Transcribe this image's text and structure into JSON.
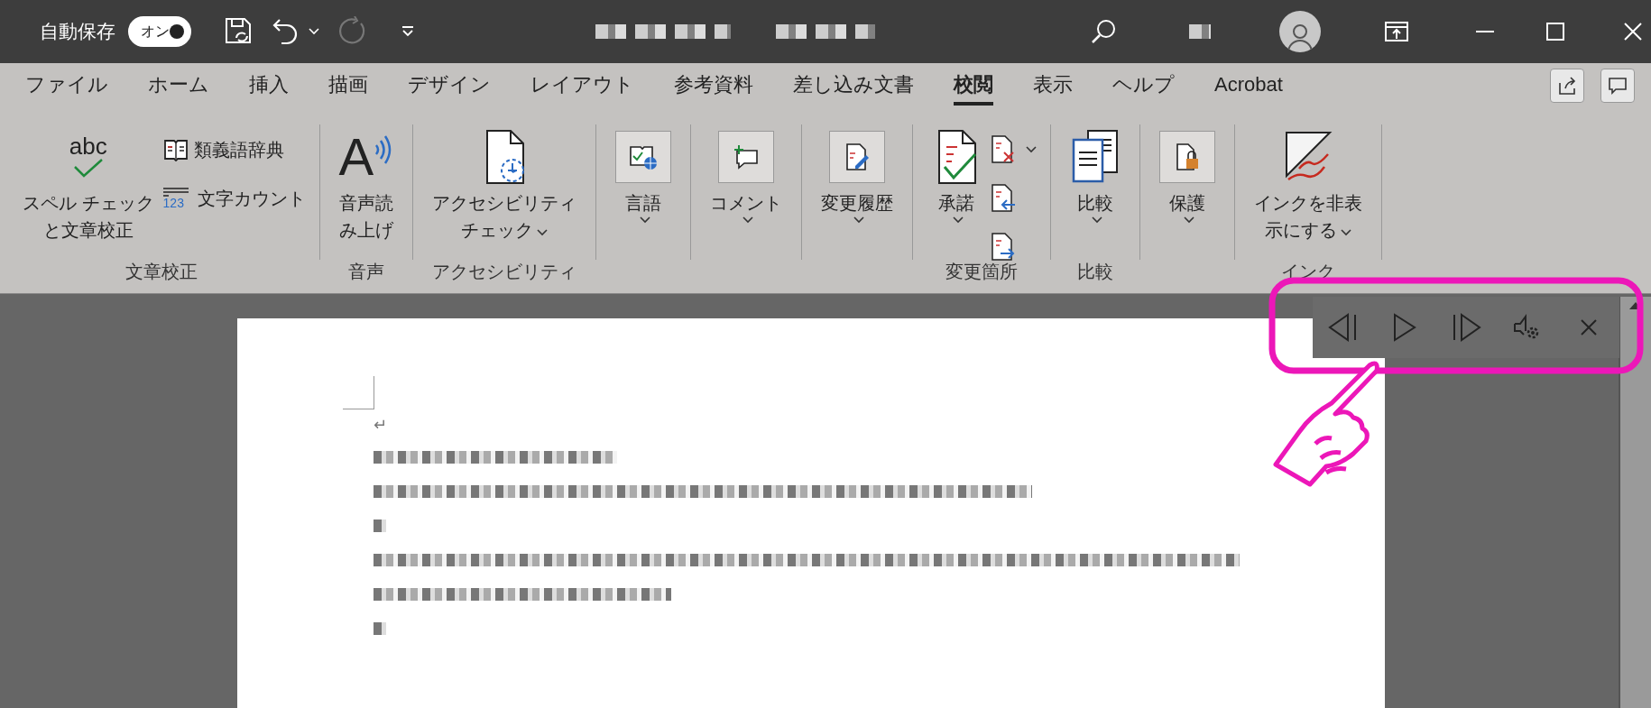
{
  "title_bar": {
    "autosave_label": "自動保存",
    "autosave_toggle": {
      "label": "オン",
      "on": true
    },
    "redo": {
      "disabled": true
    }
  },
  "tabs": [
    {
      "label": "ファイル",
      "selected": false
    },
    {
      "label": "ホーム",
      "selected": false
    },
    {
      "label": "挿入",
      "selected": false
    },
    {
      "label": "描画",
      "selected": false
    },
    {
      "label": "デザイン",
      "selected": false
    },
    {
      "label": "レイアウト",
      "selected": false
    },
    {
      "label": "参考資料",
      "selected": false
    },
    {
      "label": "差し込み文書",
      "selected": false
    },
    {
      "label": "校閲",
      "selected": true
    },
    {
      "label": "表示",
      "selected": false
    },
    {
      "label": "ヘルプ",
      "selected": false
    },
    {
      "label": "Acrobat",
      "selected": false
    }
  ],
  "ribbon": {
    "groups": [
      {
        "label": "文章校正",
        "items": [
          {
            "kind": "large",
            "lines": [
              "スペル チェック",
              "と文章校正"
            ],
            "icon_text": "abc",
            "dropdown": false
          },
          {
            "kind": "small",
            "label": "類義語辞典",
            "dropdown": false
          },
          {
            "kind": "small",
            "label": "文字カウント",
            "icon_text": "123",
            "dropdown": false
          }
        ]
      },
      {
        "label": "音声",
        "items": [
          {
            "kind": "large",
            "lines": [
              "音声読",
              "み上げ"
            ],
            "icon_text": "A",
            "dropdown": false
          }
        ]
      },
      {
        "label": "アクセシビリティ",
        "items": [
          {
            "kind": "large",
            "lines": [
              "アクセシビリティ",
              "チェック"
            ],
            "dropdown": true
          }
        ]
      },
      {
        "items": [
          {
            "kind": "boxed",
            "lines": [
              "言語"
            ],
            "dropdown": true
          }
        ]
      },
      {
        "items": [
          {
            "kind": "boxed",
            "lines": [
              "コメント"
            ],
            "dropdown": true
          }
        ]
      },
      {
        "items": [
          {
            "kind": "boxed",
            "lines": [
              "変更履歴"
            ],
            "dropdown": true
          }
        ]
      },
      {
        "label": "変更箇所",
        "items": [
          {
            "kind": "large",
            "lines": [
              "承諾"
            ],
            "dropdown": true
          },
          {
            "kind": "small",
            "dropdown": true
          },
          {
            "kind": "small",
            "dropdown": false
          },
          {
            "kind": "small",
            "dropdown": false
          }
        ]
      },
      {
        "label": "比較",
        "items": [
          {
            "kind": "large",
            "lines": [
              "比較"
            ],
            "dropdown": true
          }
        ]
      },
      {
        "items": [
          {
            "kind": "boxed",
            "lines": [
              "保護"
            ],
            "dropdown": true
          }
        ]
      },
      {
        "label": "インク",
        "items": [
          {
            "kind": "large",
            "lines": [
              "インクを非表",
              "示にする"
            ],
            "dropdown": true
          }
        ]
      }
    ]
  },
  "document": {
    "paragraph_mark": "↵"
  }
}
